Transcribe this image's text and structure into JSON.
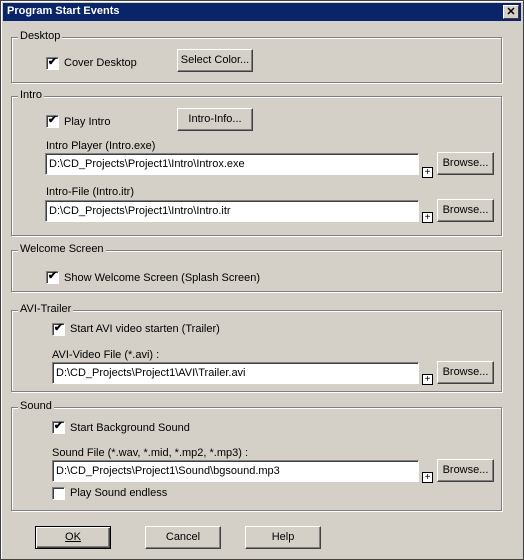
{
  "window": {
    "title": "Program Start Events"
  },
  "desktop": {
    "legend": "Desktop",
    "cover_desktop_label": "Cover Desktop",
    "cover_desktop_checked": true,
    "select_color_label": "Select Color..."
  },
  "intro": {
    "legend": "Intro",
    "play_intro_label": "Play Intro",
    "play_intro_checked": true,
    "intro_info_label": "Intro-Info...",
    "player_label": "Intro Player (Intro.exe)",
    "player_value": "D:\\CD_Projects\\Project1\\Intro\\Introx.exe",
    "file_label": "Intro-File (Intro.itr)",
    "file_value": "D:\\CD_Projects\\Project1\\Intro\\Intro.itr",
    "browse_label": "Browse..."
  },
  "welcome": {
    "legend": "Welcome Screen",
    "show_label": "Show Welcome Screen (Splash Screen)",
    "show_checked": true
  },
  "avi": {
    "legend": "AVI-Trailer",
    "start_label": "Start AVI video starten (Trailer)",
    "start_checked": true,
    "file_label": "AVI-Video File (*.avi) :",
    "file_value": "D:\\CD_Projects\\Project1\\AVI\\Trailer.avi",
    "browse_label": "Browse..."
  },
  "sound": {
    "legend": "Sound",
    "start_label": "Start Background Sound",
    "start_checked": true,
    "file_label": "Sound File (*.wav, *.mid, *.mp2, *.mp3) :",
    "file_value": "D:\\CD_Projects\\Project1\\Sound\\bgsound.mp3",
    "browse_label": "Browse...",
    "endless_label": "Play Sound endless",
    "endless_checked": false
  },
  "buttons": {
    "ok": "OK",
    "cancel": "Cancel",
    "help": "Help"
  },
  "glyphs": {
    "check": "✔",
    "close": "✕",
    "plus": "+"
  }
}
